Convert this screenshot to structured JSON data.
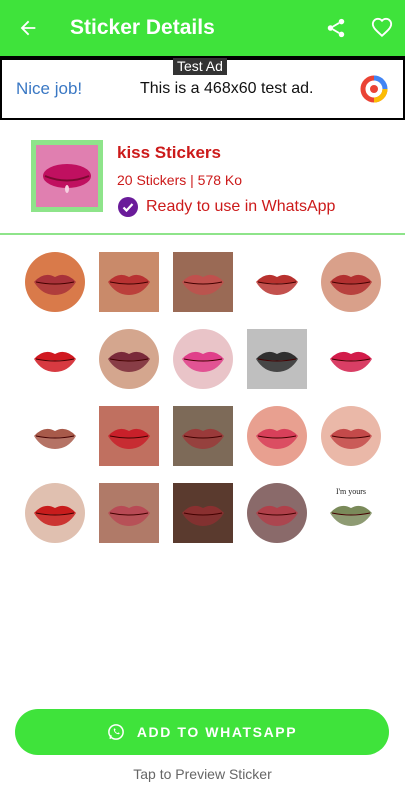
{
  "appbar": {
    "title": "Sticker Details",
    "back_icon": "arrow-back-icon",
    "share_icon": "share-icon",
    "favorite_icon": "heart-outline-icon",
    "color": "#3fe33b"
  },
  "ad": {
    "label": "Test Ad",
    "headline": "Nice job!",
    "message": "This is a 468x60 test ad."
  },
  "pack": {
    "name": "kiss Stickers",
    "meta": "20 Stickers | 578 Ko",
    "status": "Ready to use in WhatsApp",
    "text_color": "#cc1a1a"
  },
  "stickers": [
    {
      "shape": "circle",
      "bg": "#d97a4a",
      "lip": "#a8323a"
    },
    {
      "shape": "square",
      "bg": "#c98a6a",
      "lip": "#b83232"
    },
    {
      "shape": "square",
      "bg": "#9a6a55",
      "lip": "#c0504d"
    },
    {
      "shape": "none",
      "bg": "#ffffff",
      "lip": "#b8322f"
    },
    {
      "shape": "circle",
      "bg": "#d9a08a",
      "lip": "#b23030"
    },
    {
      "shape": "none",
      "bg": "#ffffff",
      "lip": "#d01820"
    },
    {
      "shape": "circle",
      "bg": "#d4a68e",
      "lip": "#7a2a3a"
    },
    {
      "shape": "circle",
      "bg": "#e9c4c8",
      "lip": "#e0408a"
    },
    {
      "shape": "square",
      "bg": "#bfbfbf",
      "lip": "#303030"
    },
    {
      "shape": "none",
      "bg": "#ffffff",
      "lip": "#d21c4a"
    },
    {
      "shape": "none",
      "bg": "#ffffff",
      "lip": "#a85a4a"
    },
    {
      "shape": "square",
      "bg": "#c07060",
      "lip": "#c8202a"
    },
    {
      "shape": "square",
      "bg": "#7d6a58",
      "lip": "#9a3a3a"
    },
    {
      "shape": "circle",
      "bg": "#e8a090",
      "lip": "#d8405a"
    },
    {
      "shape": "circle",
      "bg": "#eab8a8",
      "lip": "#c44a4a"
    },
    {
      "shape": "circle",
      "bg": "#e0c0b0",
      "lip": "#c81c1c"
    },
    {
      "shape": "square",
      "bg": "#b07a68",
      "lip": "#b84a55"
    },
    {
      "shape": "square",
      "bg": "#5a3a2e",
      "lip": "#8a3030"
    },
    {
      "shape": "circle",
      "bg": "#8a6a6a",
      "lip": "#b0404a"
    },
    {
      "shape": "none",
      "bg": "#ffffff",
      "lip": "#7a8a5a",
      "caption": "I'm yours"
    }
  ],
  "cta": {
    "label": "ADD TO WHATSAPP",
    "hint": "Tap to Preview Sticker"
  }
}
